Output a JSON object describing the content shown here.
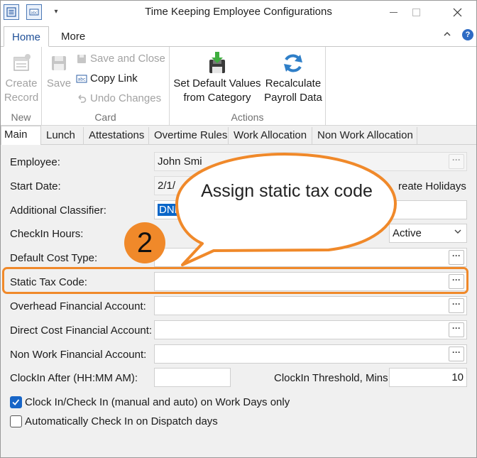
{
  "window": {
    "title": "Time Keeping Employee Configurations"
  },
  "ribbon": {
    "tabs": [
      {
        "label": "Home",
        "active": true
      },
      {
        "label": "More",
        "active": false
      }
    ],
    "groups": {
      "new": {
        "label": "New",
        "create_record": "Create Record"
      },
      "card": {
        "label": "Card",
        "save": "Save",
        "save_and_close": "Save and Close",
        "copy_link": "Copy Link",
        "undo_changes": "Undo Changes"
      },
      "actions": {
        "label": "Actions",
        "set_default_values": "Set Default Values from Category",
        "recalculate_payroll": "Recalculate Payroll Data"
      }
    }
  },
  "content_tabs": [
    {
      "label": "Main",
      "active": true
    },
    {
      "label": "Lunch",
      "active": false
    },
    {
      "label": "Attestations",
      "active": false
    },
    {
      "label": "Overtime Rules",
      "active": false
    },
    {
      "label": "Work Allocation",
      "active": false
    },
    {
      "label": "Non Work Allocation",
      "active": false
    }
  ],
  "form": {
    "employee": {
      "label": "Employee:",
      "value": "John Smi"
    },
    "start_date": {
      "label": "Start Date:",
      "value": "2/1/"
    },
    "create_holidays": {
      "label": "reate Holidays"
    },
    "additional_classifier": {
      "label": "Additional Classifier:",
      "value": "DND"
    },
    "checkin_hours": {
      "label": "CheckIn Hours:",
      "status_value": "Active"
    },
    "default_cost_type": {
      "label": "Default Cost Type:",
      "value": ""
    },
    "static_tax_code": {
      "label": "Static Tax Code:",
      "value": ""
    },
    "overhead_financial_account": {
      "label": "Overhead Financial Account:",
      "value": ""
    },
    "direct_cost_financial_account": {
      "label": "Direct Cost Financial Account:",
      "value": ""
    },
    "non_work_financial_account": {
      "label": "Non Work Financial Account:",
      "value": ""
    },
    "clockin_after": {
      "label": "ClockIn After (HH:MM AM):",
      "value": ""
    },
    "clockin_threshold": {
      "label": "ClockIn Threshold, Mins:",
      "value": "10"
    },
    "clock_in_work_days_only": {
      "label": "Clock In/Check In (manual and auto) on Work Days only",
      "checked": true
    },
    "auto_check_in_dispatch": {
      "label": "Automatically Check In on Dispatch days",
      "checked": false
    }
  },
  "callout": {
    "text": "Assign static tax code",
    "step_number": "2",
    "color": "#f0892a"
  },
  "colors": {
    "accent": "#1e4f97",
    "selection": "#0a66c8",
    "checkbox": "#1765c7"
  }
}
